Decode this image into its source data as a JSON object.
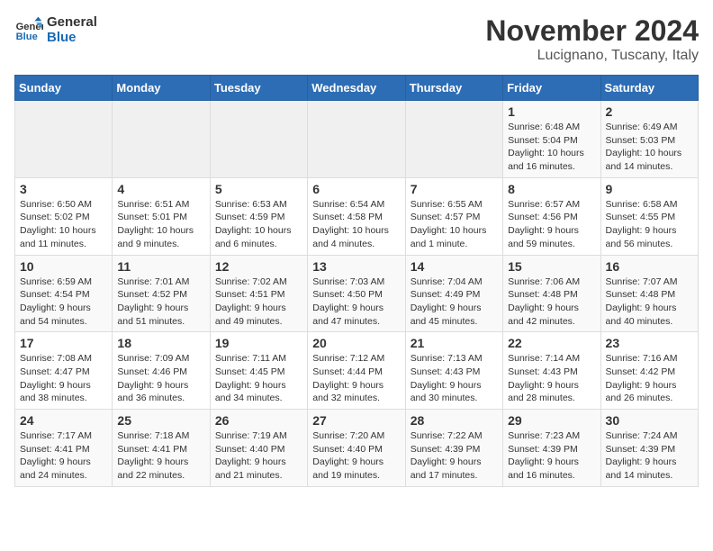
{
  "logo": {
    "line1": "General",
    "line2": "Blue"
  },
  "title": "November 2024",
  "location": "Lucignano, Tuscany, Italy",
  "weekdays": [
    "Sunday",
    "Monday",
    "Tuesday",
    "Wednesday",
    "Thursday",
    "Friday",
    "Saturday"
  ],
  "weeks": [
    [
      {
        "day": "",
        "info": ""
      },
      {
        "day": "",
        "info": ""
      },
      {
        "day": "",
        "info": ""
      },
      {
        "day": "",
        "info": ""
      },
      {
        "day": "",
        "info": ""
      },
      {
        "day": "1",
        "info": "Sunrise: 6:48 AM\nSunset: 5:04 PM\nDaylight: 10 hours and 16 minutes."
      },
      {
        "day": "2",
        "info": "Sunrise: 6:49 AM\nSunset: 5:03 PM\nDaylight: 10 hours and 14 minutes."
      }
    ],
    [
      {
        "day": "3",
        "info": "Sunrise: 6:50 AM\nSunset: 5:02 PM\nDaylight: 10 hours and 11 minutes."
      },
      {
        "day": "4",
        "info": "Sunrise: 6:51 AM\nSunset: 5:01 PM\nDaylight: 10 hours and 9 minutes."
      },
      {
        "day": "5",
        "info": "Sunrise: 6:53 AM\nSunset: 4:59 PM\nDaylight: 10 hours and 6 minutes."
      },
      {
        "day": "6",
        "info": "Sunrise: 6:54 AM\nSunset: 4:58 PM\nDaylight: 10 hours and 4 minutes."
      },
      {
        "day": "7",
        "info": "Sunrise: 6:55 AM\nSunset: 4:57 PM\nDaylight: 10 hours and 1 minute."
      },
      {
        "day": "8",
        "info": "Sunrise: 6:57 AM\nSunset: 4:56 PM\nDaylight: 9 hours and 59 minutes."
      },
      {
        "day": "9",
        "info": "Sunrise: 6:58 AM\nSunset: 4:55 PM\nDaylight: 9 hours and 56 minutes."
      }
    ],
    [
      {
        "day": "10",
        "info": "Sunrise: 6:59 AM\nSunset: 4:54 PM\nDaylight: 9 hours and 54 minutes."
      },
      {
        "day": "11",
        "info": "Sunrise: 7:01 AM\nSunset: 4:52 PM\nDaylight: 9 hours and 51 minutes."
      },
      {
        "day": "12",
        "info": "Sunrise: 7:02 AM\nSunset: 4:51 PM\nDaylight: 9 hours and 49 minutes."
      },
      {
        "day": "13",
        "info": "Sunrise: 7:03 AM\nSunset: 4:50 PM\nDaylight: 9 hours and 47 minutes."
      },
      {
        "day": "14",
        "info": "Sunrise: 7:04 AM\nSunset: 4:49 PM\nDaylight: 9 hours and 45 minutes."
      },
      {
        "day": "15",
        "info": "Sunrise: 7:06 AM\nSunset: 4:48 PM\nDaylight: 9 hours and 42 minutes."
      },
      {
        "day": "16",
        "info": "Sunrise: 7:07 AM\nSunset: 4:48 PM\nDaylight: 9 hours and 40 minutes."
      }
    ],
    [
      {
        "day": "17",
        "info": "Sunrise: 7:08 AM\nSunset: 4:47 PM\nDaylight: 9 hours and 38 minutes."
      },
      {
        "day": "18",
        "info": "Sunrise: 7:09 AM\nSunset: 4:46 PM\nDaylight: 9 hours and 36 minutes."
      },
      {
        "day": "19",
        "info": "Sunrise: 7:11 AM\nSunset: 4:45 PM\nDaylight: 9 hours and 34 minutes."
      },
      {
        "day": "20",
        "info": "Sunrise: 7:12 AM\nSunset: 4:44 PM\nDaylight: 9 hours and 32 minutes."
      },
      {
        "day": "21",
        "info": "Sunrise: 7:13 AM\nSunset: 4:43 PM\nDaylight: 9 hours and 30 minutes."
      },
      {
        "day": "22",
        "info": "Sunrise: 7:14 AM\nSunset: 4:43 PM\nDaylight: 9 hours and 28 minutes."
      },
      {
        "day": "23",
        "info": "Sunrise: 7:16 AM\nSunset: 4:42 PM\nDaylight: 9 hours and 26 minutes."
      }
    ],
    [
      {
        "day": "24",
        "info": "Sunrise: 7:17 AM\nSunset: 4:41 PM\nDaylight: 9 hours and 24 minutes."
      },
      {
        "day": "25",
        "info": "Sunrise: 7:18 AM\nSunset: 4:41 PM\nDaylight: 9 hours and 22 minutes."
      },
      {
        "day": "26",
        "info": "Sunrise: 7:19 AM\nSunset: 4:40 PM\nDaylight: 9 hours and 21 minutes."
      },
      {
        "day": "27",
        "info": "Sunrise: 7:20 AM\nSunset: 4:40 PM\nDaylight: 9 hours and 19 minutes."
      },
      {
        "day": "28",
        "info": "Sunrise: 7:22 AM\nSunset: 4:39 PM\nDaylight: 9 hours and 17 minutes."
      },
      {
        "day": "29",
        "info": "Sunrise: 7:23 AM\nSunset: 4:39 PM\nDaylight: 9 hours and 16 minutes."
      },
      {
        "day": "30",
        "info": "Sunrise: 7:24 AM\nSunset: 4:39 PM\nDaylight: 9 hours and 14 minutes."
      }
    ]
  ]
}
